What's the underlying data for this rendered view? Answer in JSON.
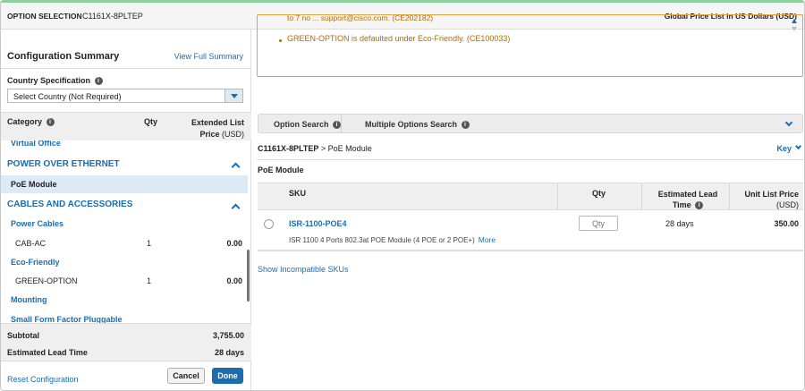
{
  "header": {
    "label": "OPTION SELECTION",
    "model": "C1161X-8PLTEP",
    "price_list": "Global Price List in US Dollars (USD)"
  },
  "summary_panel": {
    "title": "Configuration Summary",
    "view_full": "View Full Summary",
    "country_label": "Country Specification",
    "country_value": "Select Country (Not Required)",
    "columns": {
      "category": "Category",
      "qty": "Qty",
      "ext_price": "Extended List",
      "ext_price_unit": "Price",
      "ext_price_currency": "(USD)"
    },
    "items": {
      "virtual_office": "Virtual Office",
      "poe_section": "POWER OVER ETHERNET",
      "poe_module": "PoE Module",
      "cables_section": "CABLES AND ACCESSORIES",
      "power_cables": "Power Cables",
      "cab_ac": {
        "name": "CAB-AC",
        "qty": "1",
        "price": "0.00"
      },
      "eco_friendly": "Eco-Friendly",
      "green_option": {
        "name": "GREEN-OPTION",
        "qty": "1",
        "price": "0.00"
      },
      "mounting": "Mounting",
      "small_form": "Small Form Factor Pluggable"
    },
    "subtotal_label": "Subtotal",
    "subtotal_value": "3,755.00",
    "lead_label": "Estimated Lead Time",
    "lead_value": "28 days",
    "reset": "Reset Configuration",
    "cancel": "Cancel",
    "done": "Done"
  },
  "notice": {
    "line1": "to 7 no ... support@cisco.com. (CE202182)",
    "line2": "GREEN-OPTION is defaulted under Eco-Friendly. (CE100033)"
  },
  "search": {
    "option_search": "Option Search",
    "multiple_search": "Multiple Options Search"
  },
  "breadcrumb": {
    "model": "C1161X-8PLTEP",
    "sep": ">",
    "current": "PoE Module",
    "key": "Key"
  },
  "section_title": "PoE Module",
  "table": {
    "headers": {
      "sku": "SKU",
      "qty": "Qty",
      "lead1": "Estimated Lead",
      "lead2": "Time",
      "price1": "Unit List Price",
      "price2": "(USD)"
    },
    "rows": [
      {
        "sku": "ISR-1100-POE4",
        "desc": "ISR 1100 4 Ports 802.3at POE Module (4 POE or 2 POE+)",
        "more": "More",
        "qty_placeholder": "Qty",
        "lead": "28 days",
        "price": "350.00"
      }
    ]
  },
  "show_incompatible": "Show Incompatible SKUs"
}
